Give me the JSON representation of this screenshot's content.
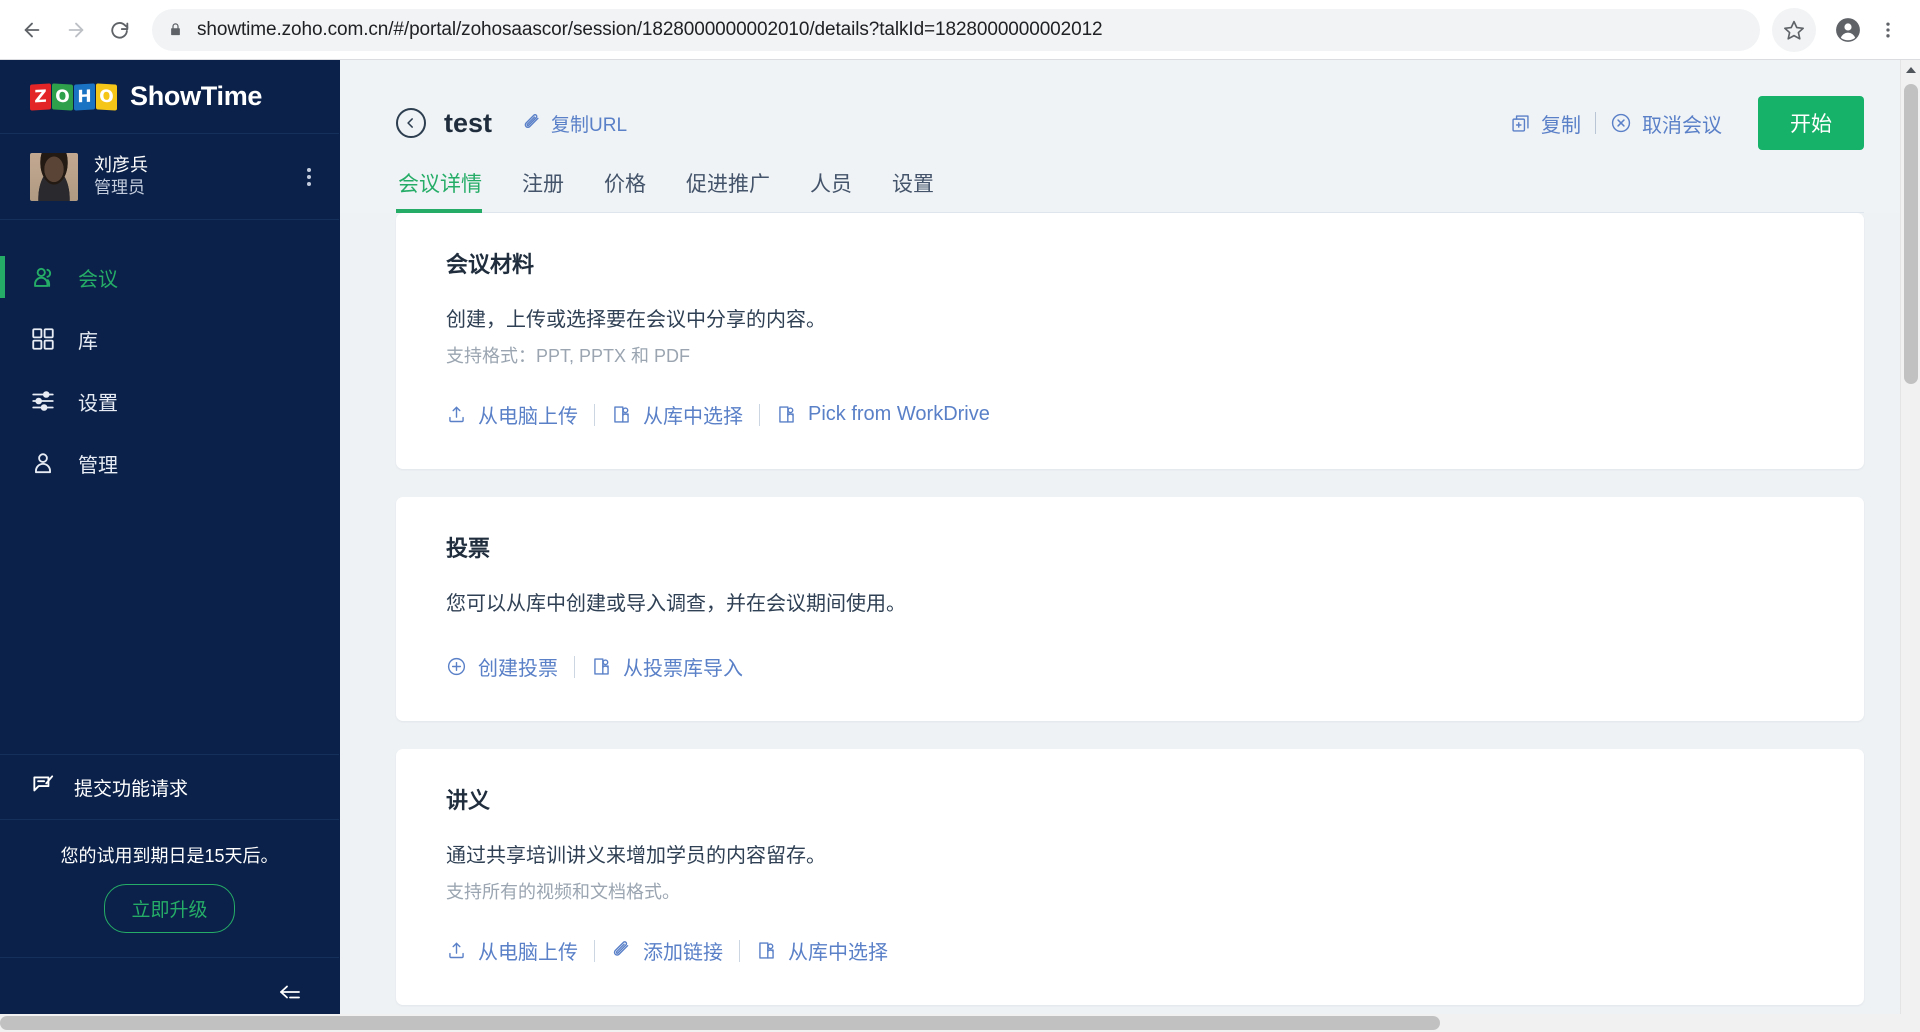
{
  "browser": {
    "back_icon": "back-arrow-icon",
    "forward_icon": "forward-arrow-icon",
    "reload_icon": "reload-icon",
    "lock_icon": "lock-icon",
    "url": "showtime.zoho.com.cn/#/portal/zohosaascor/session/1828000000002010/details?talkId=1828000000002012",
    "url_host": "showtime.zoho.com.cn",
    "url_path": "/#/portal/zohosaascor/session/1828000000002010/details?talkId=1828000000002012",
    "star_icon": "bookmark-star-icon",
    "profile_icon": "profile-avatar-icon",
    "menu_icon": "three-dot-menu-icon"
  },
  "sidebar": {
    "logo": {
      "blocks": [
        "Z",
        "O",
        "H",
        "O"
      ],
      "product": "ShowTime",
      "colors": [
        "#e42527",
        "#2e9f4b",
        "#1a73c3",
        "#f5c518"
      ]
    },
    "profile": {
      "name": "刘彦兵",
      "role": "管理员",
      "kebab_icon": "kebab-menu-icon"
    },
    "items": [
      {
        "label": "会议",
        "icon": "people-icon",
        "active": true
      },
      {
        "label": "库",
        "icon": "grid-squares-icon",
        "active": false
      },
      {
        "label": "设置",
        "icon": "sliders-icon",
        "active": false
      },
      {
        "label": "管理",
        "icon": "person-icon",
        "active": false
      }
    ],
    "feature_request": {
      "label": "提交功能请求",
      "icon": "feedback-flag-icon"
    },
    "trial": {
      "text": "您的试用到期日是15天后。",
      "upgrade_label": "立即升级",
      "accent": "#25ad67"
    },
    "collapse_icon": "collapse-sidebar-icon",
    "bg": "#0b2149"
  },
  "header": {
    "back_icon": "back-circle-icon",
    "title": "test",
    "copy_url": {
      "label": "复制URL",
      "icon": "link-paperclip-icon"
    },
    "actions": {
      "duplicate": {
        "label": "复制",
        "icon": "duplicate-icon"
      },
      "cancel": {
        "label": "取消会议",
        "icon": "cancel-circle-icon"
      },
      "start": {
        "label": "开始",
        "color": "#17b26a"
      }
    }
  },
  "tabs": [
    {
      "label": "会议详情",
      "active": true
    },
    {
      "label": "注册",
      "active": false
    },
    {
      "label": "价格",
      "active": false
    },
    {
      "label": "促进推广",
      "active": false
    },
    {
      "label": "人员",
      "active": false
    },
    {
      "label": "设置",
      "active": false
    }
  ],
  "cards": [
    {
      "title": "会议材料",
      "desc": "创建，上传或选择要在会议中分享的内容。",
      "sub": "支持格式：PPT, PPTX 和 PDF",
      "actions": [
        {
          "label": "从电脑上传",
          "icon": "upload-icon"
        },
        {
          "label": "从库中选择",
          "icon": "library-pick-icon"
        },
        {
          "label": "Pick from WorkDrive",
          "icon": "library-pick-icon"
        }
      ]
    },
    {
      "title": "投票",
      "desc": "您可以从库中创建或导入调查，并在会议期间使用。",
      "sub": "",
      "actions": [
        {
          "label": "创建投票",
          "icon": "plus-circle-icon"
        },
        {
          "label": "从投票库导入",
          "icon": "library-pick-icon"
        }
      ]
    },
    {
      "title": "讲义",
      "desc": "通过共享培训讲义来增加学员的内容留存。",
      "sub": "支持所有的视频和文档格式。",
      "actions": [
        {
          "label": "从电脑上传",
          "icon": "upload-icon"
        },
        {
          "label": "添加链接",
          "icon": "link-paperclip-icon"
        },
        {
          "label": "从库中选择",
          "icon": "library-pick-icon"
        }
      ]
    }
  ],
  "scrollbars": {
    "vertical_up_icon": "scroll-up-arrow-icon",
    "horizontal": true
  }
}
